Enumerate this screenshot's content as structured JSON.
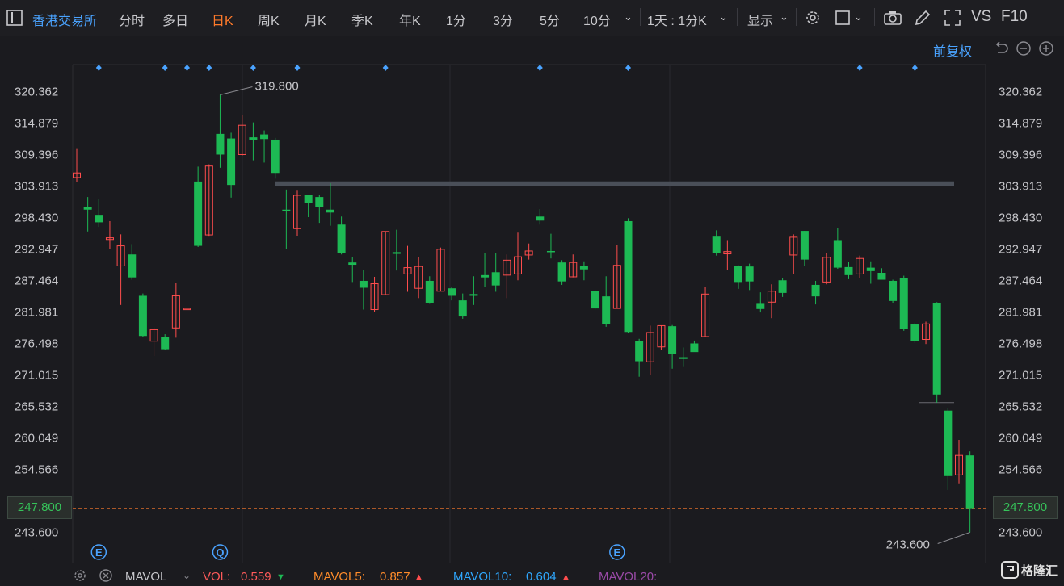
{
  "toolbar": {
    "exchange": "香港交易所",
    "periods": [
      "分时",
      "多日",
      "日K",
      "周K",
      "月K",
      "季K",
      "年K",
      "1分",
      "3分",
      "5分",
      "10分"
    ],
    "active_period": "日K",
    "interval_select": "1天 : 1分K",
    "display_label": "显示",
    "vs_label": "VS",
    "f10_label": "F10"
  },
  "adjust": {
    "label": "前复权"
  },
  "chart_data": {
    "type": "candlestick",
    "y_ticks": [
      "320.362",
      "314.879",
      "309.396",
      "303.913",
      "298.430",
      "292.947",
      "287.464",
      "281.981",
      "276.498",
      "271.015",
      "265.532",
      "260.049",
      "254.566",
      "249.083",
      "243.600"
    ],
    "ylim": [
      243.6,
      320.362
    ],
    "annotations": {
      "high": "319.800",
      "low": "243.600"
    },
    "current_price": "247.800",
    "resistance_level": 304.3,
    "support_level": 266.2,
    "candles": [
      {
        "o": 305.4,
        "c": 306.2,
        "h": 310.5,
        "l": 304.6
      },
      {
        "o": 300.2,
        "c": 299.8,
        "h": 302.0,
        "l": 296.0
      },
      {
        "o": 298.9,
        "c": 297.6,
        "h": 301.6,
        "l": 296.8
      },
      {
        "o": 294.6,
        "c": 294.9,
        "h": 297.8,
        "l": 292.9
      },
      {
        "o": 290.0,
        "c": 293.5,
        "h": 295.5,
        "l": 283.2
      },
      {
        "o": 292.0,
        "c": 288.0,
        "h": 293.8,
        "l": 287.6
      },
      {
        "o": 284.8,
        "c": 277.8,
        "h": 285.2,
        "l": 277.6
      },
      {
        "o": 276.9,
        "c": 278.9,
        "h": 279.3,
        "l": 274.3
      },
      {
        "o": 277.6,
        "c": 275.5,
        "h": 278.1,
        "l": 275.3
      },
      {
        "o": 279.2,
        "c": 284.8,
        "h": 287.0,
        "l": 277.5
      },
      {
        "o": 282.5,
        "c": 282.6,
        "h": 286.9,
        "l": 279.9
      },
      {
        "o": 304.7,
        "c": 293.5,
        "h": 307.3,
        "l": 293.3
      },
      {
        "o": 295.4,
        "c": 307.4,
        "h": 307.7,
        "l": 295.1
      },
      {
        "o": 313.0,
        "c": 309.4,
        "h": 319.8,
        "l": 307.1
      },
      {
        "o": 312.2,
        "c": 304.1,
        "h": 313.2,
        "l": 301.9
      },
      {
        "o": 309.4,
        "c": 314.5,
        "h": 316.3,
        "l": 309.2
      },
      {
        "o": 312.4,
        "c": 312.0,
        "h": 315.0,
        "l": 308.4
      },
      {
        "o": 312.9,
        "c": 312.1,
        "h": 313.6,
        "l": 308.0
      },
      {
        "o": 312.0,
        "c": 306.2,
        "h": 312.3,
        "l": 305.2
      },
      {
        "o": 299.8,
        "c": 299.7,
        "h": 303.3,
        "l": 292.9
      },
      {
        "o": 296.5,
        "c": 302.3,
        "h": 303.1,
        "l": 295.2
      },
      {
        "o": 302.4,
        "c": 301.0,
        "h": 302.4,
        "l": 298.5
      },
      {
        "o": 302.0,
        "c": 300.2,
        "h": 302.3,
        "l": 297.5
      },
      {
        "o": 299.8,
        "c": 299.3,
        "h": 304.4,
        "l": 297.0
      },
      {
        "o": 297.2,
        "c": 292.2,
        "h": 298.6,
        "l": 292.0
      },
      {
        "o": 290.6,
        "c": 290.2,
        "h": 291.6,
        "l": 287.2
      },
      {
        "o": 287.4,
        "c": 286.2,
        "h": 289.3,
        "l": 282.4
      },
      {
        "o": 282.4,
        "c": 286.9,
        "h": 288.1,
        "l": 282.0
      },
      {
        "o": 285.0,
        "c": 296.0,
        "h": 296.0,
        "l": 285.0
      },
      {
        "o": 292.4,
        "c": 292.1,
        "h": 296.3,
        "l": 289.2
      },
      {
        "o": 288.6,
        "c": 289.7,
        "h": 293.5,
        "l": 285.5
      },
      {
        "o": 286.1,
        "c": 289.9,
        "h": 291.6,
        "l": 284.4
      },
      {
        "o": 287.4,
        "c": 283.6,
        "h": 288.2,
        "l": 283.4
      },
      {
        "o": 285.6,
        "c": 292.9,
        "h": 293.2,
        "l": 285.6
      },
      {
        "o": 286.1,
        "c": 284.8,
        "h": 286.3,
        "l": 284.0
      },
      {
        "o": 284.0,
        "c": 281.2,
        "h": 285.2,
        "l": 280.8
      },
      {
        "o": 285.1,
        "c": 284.8,
        "h": 288.2,
        "l": 283.2
      },
      {
        "o": 288.4,
        "c": 288.0,
        "h": 292.2,
        "l": 286.4
      },
      {
        "o": 288.9,
        "c": 286.6,
        "h": 292.2,
        "l": 285.5
      },
      {
        "o": 288.4,
        "c": 291.0,
        "h": 292.0,
        "l": 284.4
      },
      {
        "o": 288.6,
        "c": 291.6,
        "h": 295.8,
        "l": 287.5
      },
      {
        "o": 291.9,
        "c": 292.6,
        "h": 293.9,
        "l": 291.1
      },
      {
        "o": 298.6,
        "c": 297.9,
        "h": 299.9,
        "l": 297.2
      },
      {
        "o": 292.6,
        "c": 292.5,
        "h": 295.6,
        "l": 291.3
      },
      {
        "o": 290.6,
        "c": 287.3,
        "h": 291.0,
        "l": 286.7
      },
      {
        "o": 288.1,
        "c": 290.6,
        "h": 292.0,
        "l": 288.0
      },
      {
        "o": 290.0,
        "c": 289.4,
        "h": 290.8,
        "l": 287.5
      },
      {
        "o": 285.7,
        "c": 282.6,
        "h": 285.8,
        "l": 282.4
      },
      {
        "o": 284.7,
        "c": 279.8,
        "h": 288.2,
        "l": 279.4
      },
      {
        "o": 282.6,
        "c": 290.1,
        "h": 293.7,
        "l": 282.6
      },
      {
        "o": 297.8,
        "c": 278.5,
        "h": 298.3,
        "l": 278.3
      },
      {
        "o": 276.9,
        "c": 273.4,
        "h": 277.3,
        "l": 270.7
      },
      {
        "o": 273.3,
        "c": 278.4,
        "h": 279.6,
        "l": 271.0
      },
      {
        "o": 275.9,
        "c": 279.6,
        "h": 279.6,
        "l": 275.4
      },
      {
        "o": 279.5,
        "c": 274.7,
        "h": 279.7,
        "l": 272.1
      },
      {
        "o": 274.1,
        "c": 273.8,
        "h": 275.8,
        "l": 272.4
      },
      {
        "o": 276.5,
        "c": 275.0,
        "h": 277.0,
        "l": 275.1
      },
      {
        "o": 277.7,
        "c": 285.1,
        "h": 286.4,
        "l": 277.7
      },
      {
        "o": 295.1,
        "c": 292.2,
        "h": 296.2,
        "l": 291.8
      },
      {
        "o": 292.1,
        "c": 292.5,
        "h": 294.5,
        "l": 289.3
      },
      {
        "o": 290.0,
        "c": 287.2,
        "h": 290.1,
        "l": 286.0
      },
      {
        "o": 289.9,
        "c": 287.3,
        "h": 290.4,
        "l": 285.8
      },
      {
        "o": 283.4,
        "c": 282.5,
        "h": 285.4,
        "l": 281.9
      },
      {
        "o": 283.7,
        "c": 285.6,
        "h": 286.8,
        "l": 280.9
      },
      {
        "o": 287.5,
        "c": 285.3,
        "h": 287.9,
        "l": 284.6
      },
      {
        "o": 291.9,
        "c": 295.0,
        "h": 295.5,
        "l": 288.6
      },
      {
        "o": 296.1,
        "c": 291.1,
        "h": 296.1,
        "l": 290.0
      },
      {
        "o": 286.7,
        "c": 284.7,
        "h": 287.4,
        "l": 283.3
      },
      {
        "o": 287.2,
        "c": 291.5,
        "h": 292.3,
        "l": 286.8
      },
      {
        "o": 294.5,
        "c": 289.7,
        "h": 296.6,
        "l": 289.5
      },
      {
        "o": 289.8,
        "c": 288.4,
        "h": 290.7,
        "l": 287.7
      },
      {
        "o": 288.6,
        "c": 291.3,
        "h": 291.8,
        "l": 287.9
      },
      {
        "o": 289.7,
        "c": 289.1,
        "h": 290.8,
        "l": 286.9
      },
      {
        "o": 288.8,
        "c": 287.6,
        "h": 289.6,
        "l": 287.7
      },
      {
        "o": 287.4,
        "c": 283.9,
        "h": 287.6,
        "l": 283.6
      },
      {
        "o": 287.9,
        "c": 279.0,
        "h": 288.3,
        "l": 278.7
      },
      {
        "o": 279.8,
        "c": 276.9,
        "h": 280.1,
        "l": 276.6
      },
      {
        "o": 277.2,
        "c": 279.9,
        "h": 280.3,
        "l": 276.4
      },
      {
        "o": 283.6,
        "c": 267.6,
        "h": 283.7,
        "l": 266.2
      },
      {
        "o": 264.8,
        "c": 253.4,
        "h": 265.2,
        "l": 251.0
      },
      {
        "o": 253.6,
        "c": 257.0,
        "h": 259.7,
        "l": 252.0
      },
      {
        "o": 257.0,
        "c": 247.8,
        "h": 257.7,
        "l": 243.6
      }
    ],
    "markers": {
      "diamond_candle_index": [
        2,
        8,
        10,
        12,
        16,
        20,
        28,
        42,
        50,
        71,
        76
      ],
      "event_marks": [
        {
          "candle_index": 2,
          "label": "E"
        },
        {
          "candle_index": 13,
          "label": "Q"
        },
        {
          "candle_index": 49,
          "label": "E"
        }
      ]
    }
  },
  "indicator": {
    "name": "MAVOL",
    "vol_label": "VOL:",
    "vol_value": "0.559",
    "mavol5_label": "MAVOL5:",
    "mavol5_value": "0.857",
    "mavol10_label": "MAVOL10:",
    "mavol10_value": "0.604",
    "mavol20_label": "MAVOL20:"
  },
  "watermark": {
    "text": "格隆汇"
  },
  "colors": {
    "up": "#ff4d4d",
    "down": "#1db954",
    "accent": "#ff7a2a",
    "link": "#4aa3ff",
    "level_line": "#4a4f58"
  }
}
